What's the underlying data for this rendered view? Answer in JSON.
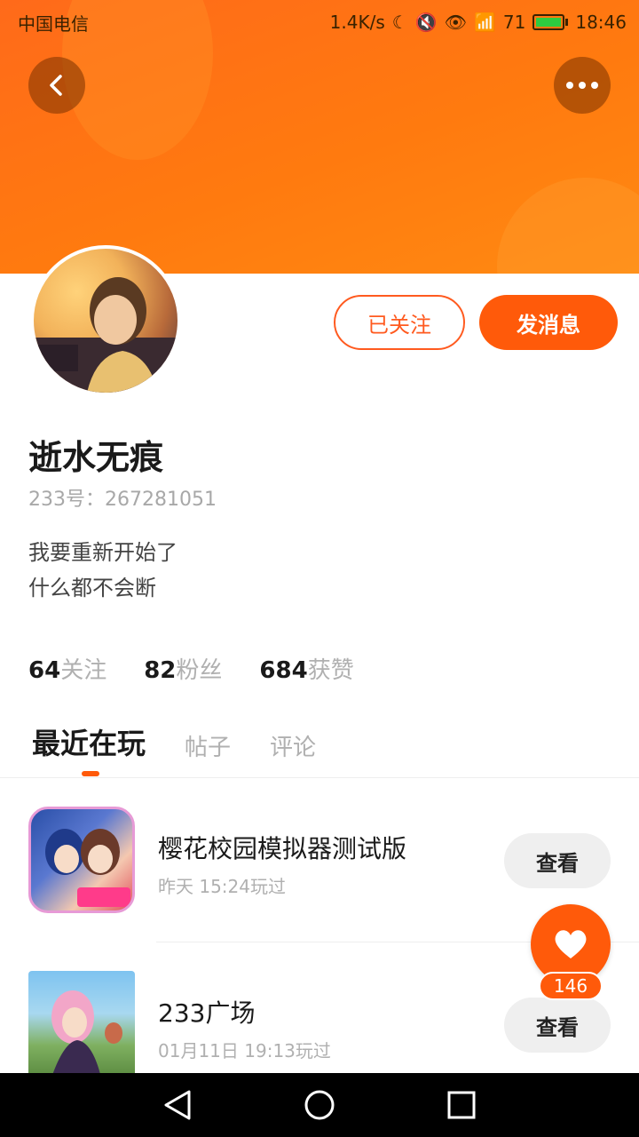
{
  "status_bar": {
    "carrier": "中国电信",
    "speed": "1.4K/s",
    "signal_text": "71",
    "time": "18:46"
  },
  "profile": {
    "name": "逝水无痕",
    "id_text": "233号：267281051",
    "bio_line1": "我要重新开始了",
    "bio_line2": "什么都不会断",
    "follow_label": "已关注",
    "message_label": "发消息"
  },
  "stats": [
    {
      "num": "64",
      "label": "关注"
    },
    {
      "num": "82",
      "label": "粉丝"
    },
    {
      "num": "684",
      "label": "获赞"
    }
  ],
  "tabs": [
    {
      "label": "最近在玩"
    },
    {
      "label": "帖子"
    },
    {
      "label": "评论"
    }
  ],
  "games": [
    {
      "title": "樱花校园模拟器测试版",
      "time": "昨天 15:24玩过",
      "button": "查看"
    },
    {
      "title": "233广场",
      "time": "01月11日 19:13玩过",
      "button": "查看"
    }
  ],
  "like": {
    "count": "146"
  },
  "colors": {
    "accent": "#ff5a0a",
    "header_top": "#ff6a1a",
    "header_bottom": "#ff8a12"
  }
}
